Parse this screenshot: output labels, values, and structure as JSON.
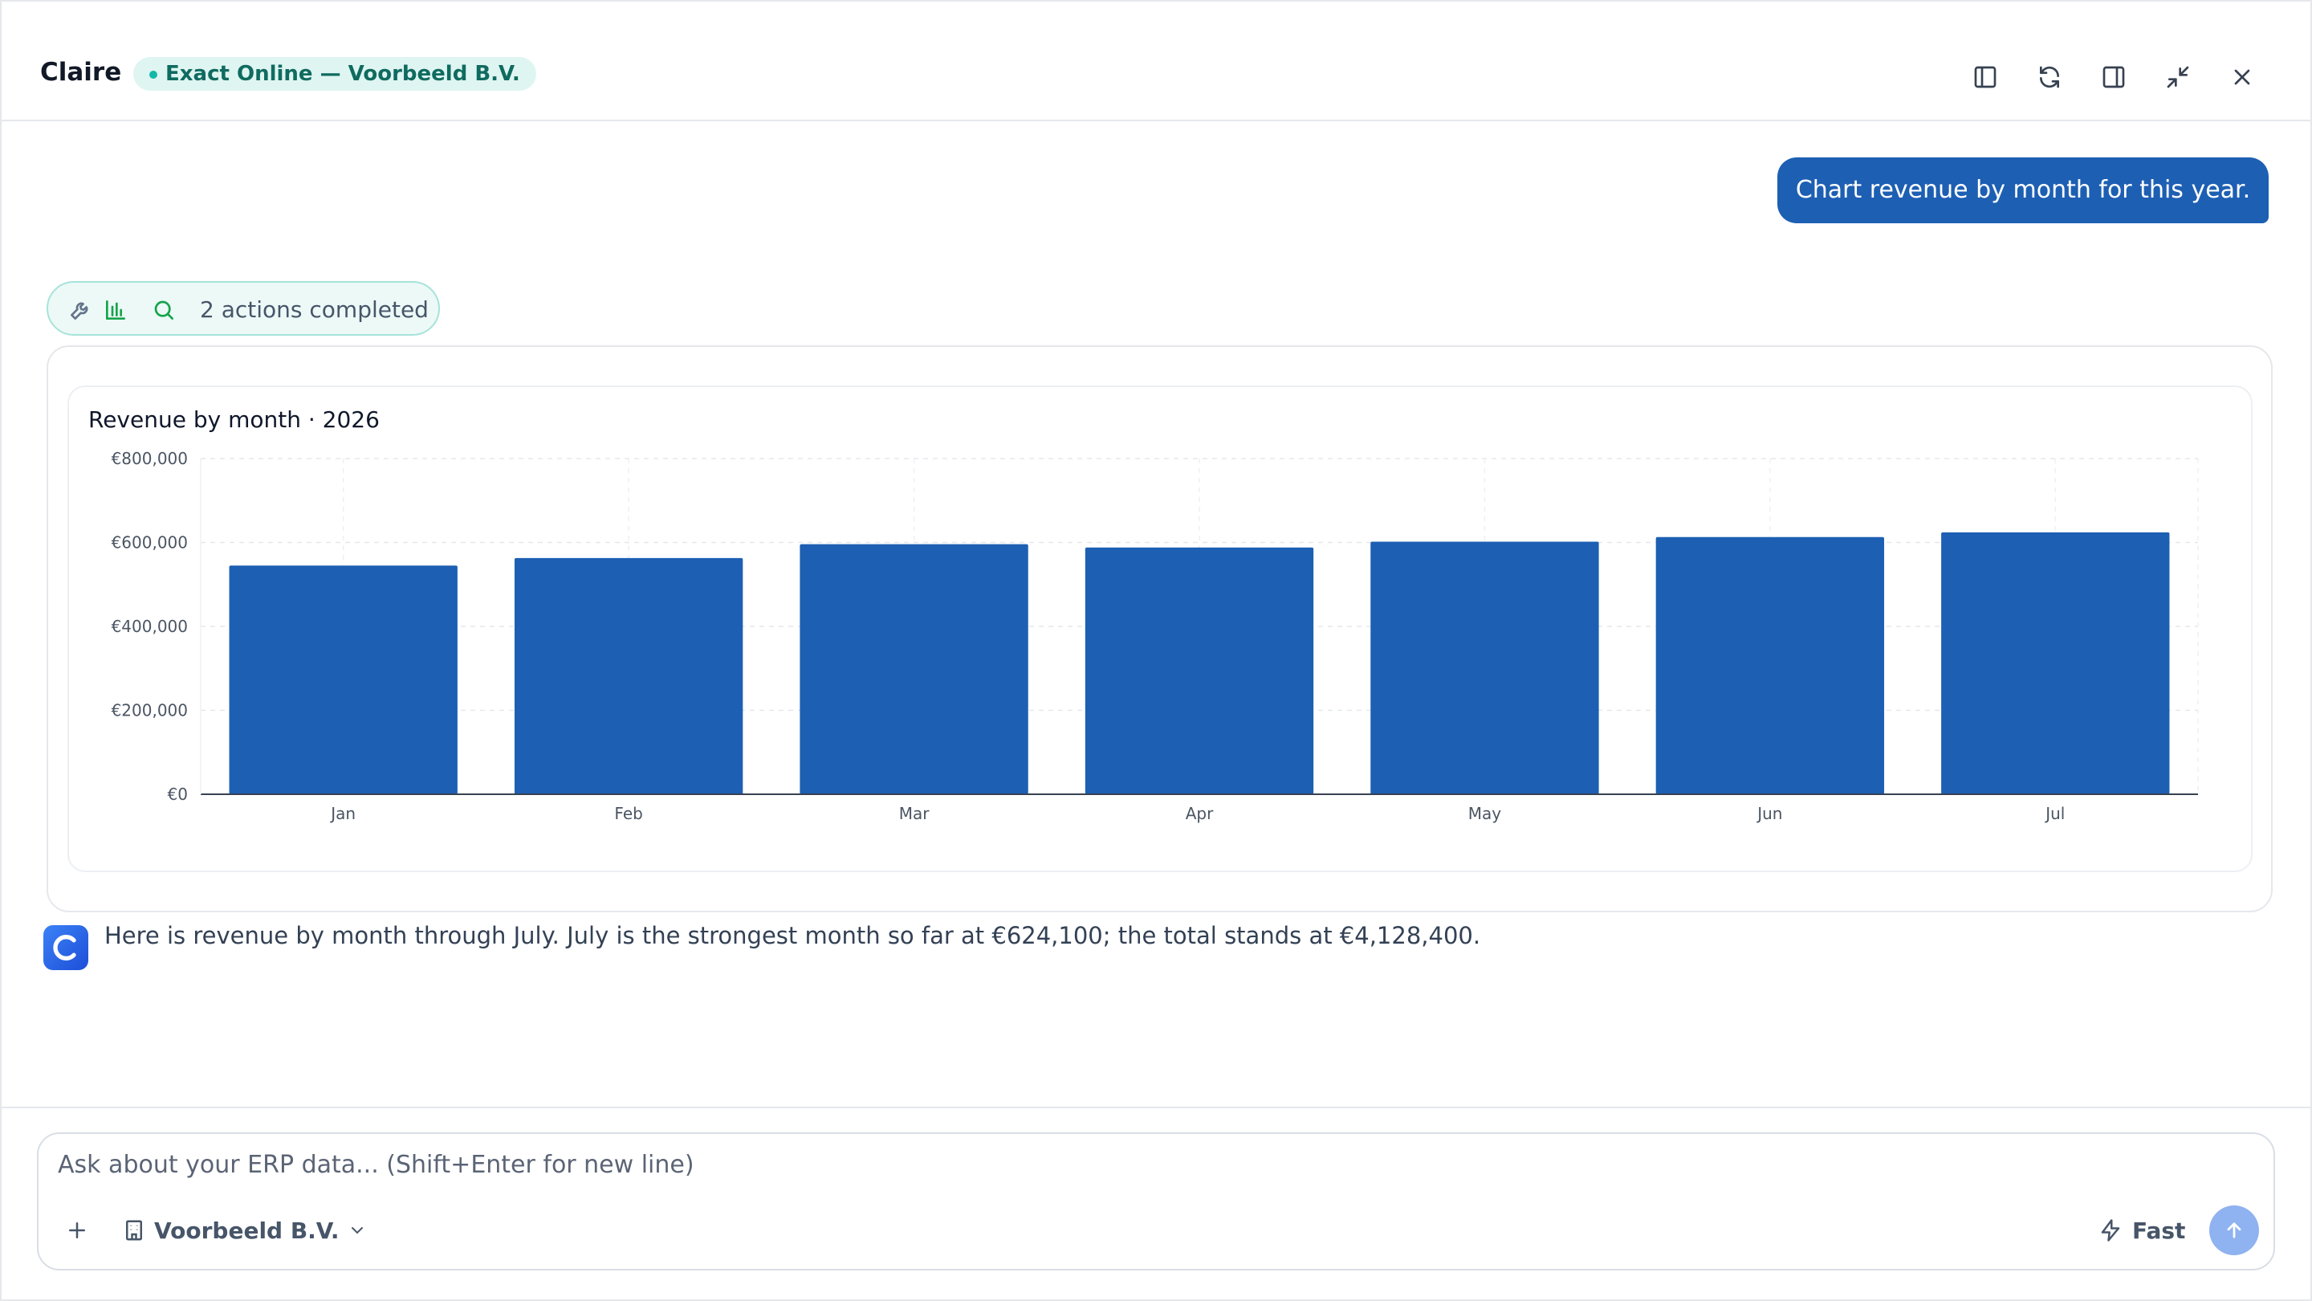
{
  "header": {
    "app_title": "Claire",
    "connection_label": "Exact Online — Voorbeeld B.V.",
    "icons": [
      "sidebar-left-icon",
      "refresh-icon",
      "sidebar-right-icon",
      "minimize-icon",
      "close-icon"
    ]
  },
  "conversation": {
    "user_message": "Chart revenue by month for this year.",
    "actions_label": "2 actions completed",
    "assistant_message": "Here is revenue by month through July. July is the strongest month so far at €624,100; the total stands at €4,128,400."
  },
  "colors": {
    "accent": "#1d5fb3",
    "badge_bg": "#dff5f2",
    "badge_text": "#0f6b5f",
    "actions_icon": "#16a34a"
  },
  "chart_data": {
    "type": "bar",
    "title": "Revenue by month · 2026",
    "categories": [
      "Jan",
      "Feb",
      "Mar",
      "Apr",
      "May",
      "Jun",
      "Jul"
    ],
    "values": [
      545000,
      563000,
      596000,
      588000,
      602000,
      613000,
      624100
    ],
    "ylim": [
      0,
      800000
    ],
    "yticks": [
      0,
      200000,
      400000,
      600000,
      800000
    ],
    "ytick_labels": [
      "€0",
      "€200,000",
      "€400,000",
      "€600,000",
      "€800,000"
    ],
    "xlabel": "",
    "ylabel": "",
    "grid": true,
    "bar_color": "#1d5fb3"
  },
  "composer": {
    "placeholder": "Ask about your ERP data... (Shift+Enter for new line)",
    "company_label": "Voorbeeld B.V.",
    "mode_label": "Fast"
  }
}
